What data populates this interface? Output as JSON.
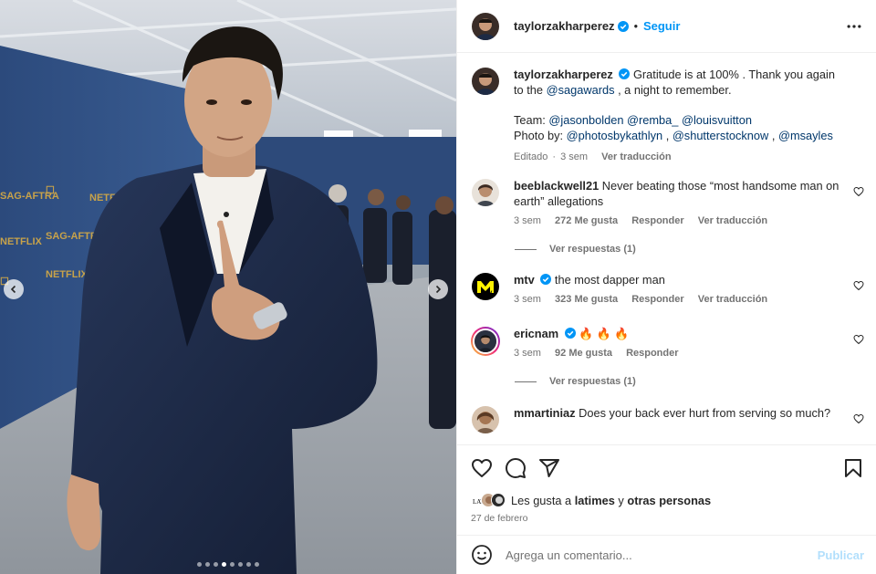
{
  "post": {
    "username": "taylorzakharperez",
    "separator": "•",
    "follow_label": "Seguir",
    "caption_parts": {
      "line1": "Gratitude is at 100% . Thank you again to",
      "the": "the",
      "mention_sag": "@sagawards",
      "rest": ", a night to remember.",
      "team_label": "Team:",
      "team_1": "@jasonbolden",
      "team_2": "@remba_",
      "team_3": "@louisvuitton",
      "photo_label": "Photo by:",
      "photo_1": "@photosbykathlyn",
      "photo_2": "@shutterstocknow",
      "photo_3": "@msayles",
      "comma": ","
    },
    "caption_meta": {
      "edited": "Editado",
      "dot": "·",
      "time": "3 sem",
      "translate": "Ver traducción"
    }
  },
  "comments": [
    {
      "username": "beeblackwell21",
      "verified": false,
      "text": "Never beating those “most handsome man on earth” allegations",
      "time": "3 sem",
      "likes": "272 Me gusta",
      "reply": "Responder",
      "translate": "Ver traducción",
      "view_replies": "Ver respuestas (1)"
    },
    {
      "username": "mtv",
      "verified": true,
      "text": "the most dapper man",
      "time": "3 sem",
      "likes": "323 Me gusta",
      "reply": "Responder",
      "translate": "Ver traducción"
    },
    {
      "username": "ericnam",
      "verified": true,
      "text": "🔥 🔥 🔥",
      "time": "3 sem",
      "likes": "92 Me gusta",
      "reply": "Responder",
      "view_replies": "Ver respuestas (1)"
    },
    {
      "username": "mmartiniaz",
      "verified": false,
      "text": "Does your back ever hurt from serving so much?"
    }
  ],
  "likes_summary": {
    "prefix": "Les gusta a",
    "user": "latimes",
    "joiner": "y",
    "others": "otras personas"
  },
  "post_date": "27 de febrero",
  "composer": {
    "placeholder": "Agrega un comentario...",
    "publish": "Publicar"
  },
  "carousel": {
    "slide_count": 8,
    "active_index": 3
  },
  "icons": [
    "heart-icon",
    "comment-icon",
    "share-icon",
    "bookmark-icon",
    "emoji-icon",
    "more-icon",
    "verified-icon"
  ],
  "colors": {
    "accent": "#0095f6",
    "mention": "#00376b",
    "muted": "#737373",
    "publish_disabled": "#b2dffc",
    "suit": "#1d2a44"
  }
}
